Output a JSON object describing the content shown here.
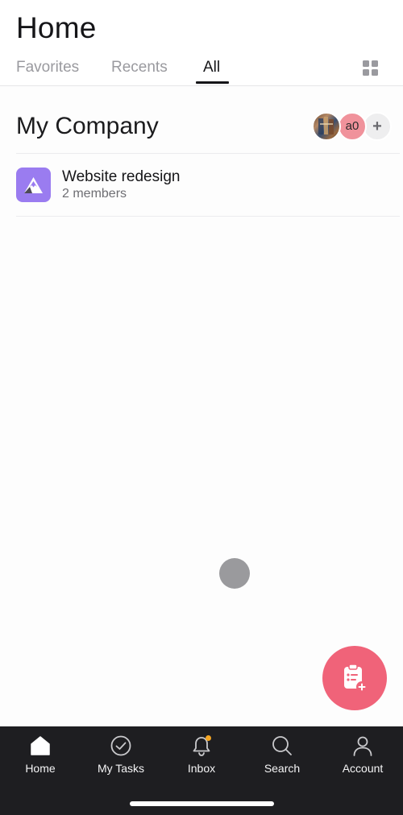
{
  "header": {
    "title": "Home",
    "tabs": [
      {
        "label": "Favorites",
        "active": false
      },
      {
        "label": "Recents",
        "active": false
      },
      {
        "label": "All",
        "active": true
      }
    ],
    "grid_view_icon": "grid-icon"
  },
  "workspace": {
    "name": "My Company",
    "members": [
      {
        "type": "photo",
        "icon": "user-photo-avatar"
      },
      {
        "type": "initials",
        "initials": "a0",
        "color": "#f0929b"
      },
      {
        "type": "add",
        "label": "+"
      }
    ]
  },
  "projects": [
    {
      "name": "Website redesign",
      "members_text": "2 members",
      "icon": "mountain-icon",
      "color": "#9a7cf0"
    }
  ],
  "fab": {
    "icon": "add-task-clipboard-icon",
    "color": "#f06379"
  },
  "tabbar": {
    "items": [
      {
        "label": "Home",
        "icon": "home-icon",
        "active": true
      },
      {
        "label": "My Tasks",
        "icon": "check-circle-icon",
        "active": false
      },
      {
        "label": "Inbox",
        "icon": "bell-icon",
        "active": false,
        "badge_color": "#f5a623"
      },
      {
        "label": "Search",
        "icon": "search-icon",
        "active": false
      },
      {
        "label": "Account",
        "icon": "person-icon",
        "active": false
      }
    ]
  },
  "colors": {
    "accent": "#f06379",
    "tabbar_bg": "#1e1e21",
    "inactive_tab": "#9a9a9f"
  }
}
